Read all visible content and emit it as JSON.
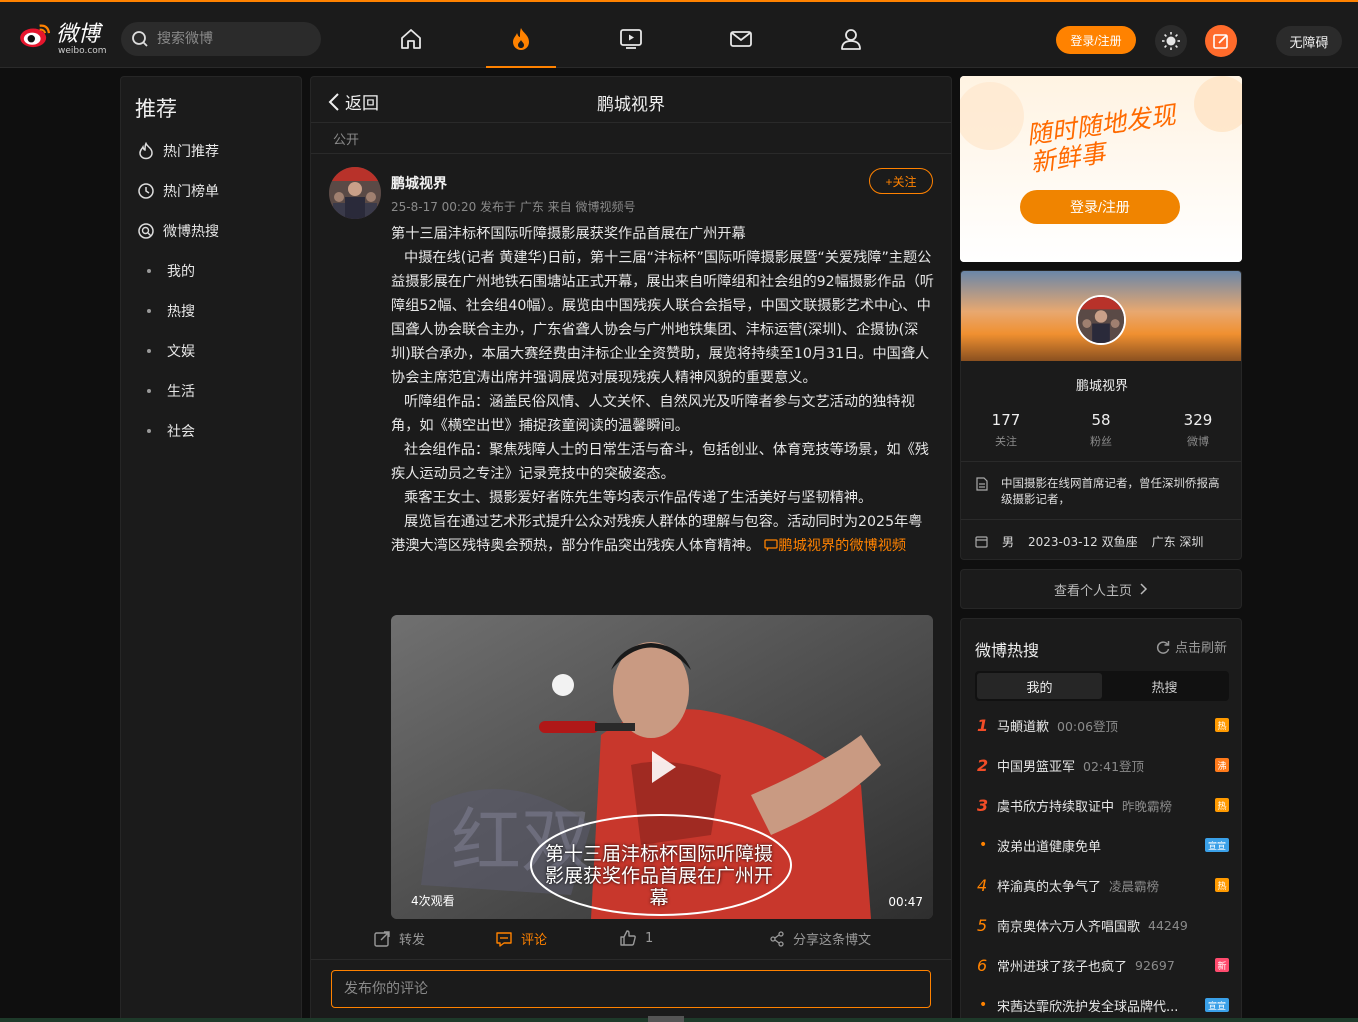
{
  "header": {
    "logo_text": "微博",
    "logo_sub": "weibo.com",
    "search_placeholder": "搜索微博",
    "login_label": "登录/注册",
    "accessibility_label": "无障碍"
  },
  "sidebar": {
    "title": "推荐",
    "items": [
      {
        "label": "热门推荐",
        "icon": "fire-icon"
      },
      {
        "label": "热门榜单",
        "icon": "clock-icon"
      },
      {
        "label": "微博热搜",
        "icon": "search-circle-icon"
      },
      {
        "label": "我的",
        "icon": "dot"
      },
      {
        "label": "热搜",
        "icon": "dot"
      },
      {
        "label": "文娱",
        "icon": "dot"
      },
      {
        "label": "生活",
        "icon": "dot"
      },
      {
        "label": "社会",
        "icon": "dot"
      }
    ]
  },
  "post": {
    "back_label": "返回",
    "page_title": "鹏城视界",
    "visibility": "公开",
    "author": "鹏城视界",
    "meta": "25-8-17 00:20 发布于 广东 来自 微博视频号",
    "follow_label": "+关注",
    "paragraphs": [
      "第十三届沣标杯国际听障摄影展获奖作品首展在广州开幕",
      "中摄在线(记者 黄建华)日前，第十三届“沣标杯”国际听障摄影展暨“关爱残障”主题公益摄影展在广州地铁石围塘站正式开幕，展出来自听障组和社会组的92幅摄影作品（听障组52幅、社会组40幅）。展览由中国残疾人联合会指导，中国文联摄影艺术中心、中国聋人协会联合主办，广东省聋人协会与广州地铁集团、沣标运营(深圳)、企摄协(深圳)联合承办，本届大赛经费由沣标企业全资赞助，展览将持续至10月31日。中国聋人协会主席范宜涛出席并强调展览对展现残疾人精神风貌的重要意义。",
      "听障组作品：涵盖民俗风情、人文关怀、自然风光及听障者参与文艺活动的独特视角，如《横空出世》捕捉孩童阅读的温馨瞬间。",
      "社会组作品：聚焦残障人士的日常生活与奋斗，包括创业、体育竞技等场景，如《残疾人运动员之专注》记录竞技中的突破姿态。",
      "乘客王女士、摄影爱好者陈先生等均表示作品传递了生活美好与坚韧精神。",
      "展览旨在通过艺术形式提升公众对残疾人群体的理解与包容。活动同时为2025年粤港澳大湾区残特奥会预热，部分作品突出残疾人体育精神。"
    ],
    "video_link": "鹏城视界的微博视频",
    "video": {
      "views": "4次观看",
      "duration": "00:47",
      "caption": "第十三届沣标杯国际听障摄影展获奖作品首展在广州开幕"
    },
    "actions": {
      "repost": "转发",
      "comment": "评论",
      "like_count": "1",
      "share": "分享这条博文"
    },
    "comment_placeholder": "发布你的评论"
  },
  "promo": {
    "slogan": "随时随地发现新鲜事",
    "button": "登录/注册"
  },
  "profile": {
    "name": "鹏城视界",
    "stats": [
      {
        "num": "177",
        "label": "关注"
      },
      {
        "num": "58",
        "label": "粉丝"
      },
      {
        "num": "329",
        "label": "微博"
      }
    ],
    "desc": "中国摄影在线网首席记者，曾任深圳侨报高级摄影记者，",
    "gender": "男",
    "birthday": "2023-03-12 双鱼座",
    "location": "广东 深圳",
    "home_link": "查看个人主页"
  },
  "hot_search": {
    "title": "微博热搜",
    "refresh": "点击刷新",
    "tabs": [
      "我的",
      "热搜"
    ],
    "items": [
      {
        "rank": "1",
        "text": "马頔道歉",
        "extra": "00:06登顶",
        "badge": "热",
        "badge_color": "#ff9a00"
      },
      {
        "rank": "2",
        "text": "中国男篮亚军",
        "extra": "02:41登顶",
        "badge": "沸",
        "badge_color": "#ff7a1a"
      },
      {
        "rank": "3",
        "text": "虞书欣方持续取证中",
        "extra": "昨晚霸榜",
        "badge": "热",
        "badge_color": "#ff9a00"
      },
      {
        "rank": "•",
        "text": "波弟出道健康免单",
        "extra": "",
        "badge": "宣宣",
        "badge_color": "#3aa0e8"
      },
      {
        "rank": "4",
        "text": "梓渝真的太争气了",
        "extra": "凌晨霸榜",
        "badge": "热",
        "badge_color": "#ff9a00"
      },
      {
        "rank": "5",
        "text": "南京奥体六万人齐唱国歌",
        "extra": "44249",
        "badge": "",
        "badge_color": ""
      },
      {
        "rank": "6",
        "text": "常州进球了孩子也疯了",
        "extra": "92697",
        "badge": "新",
        "badge_color": "#ff4b6e"
      },
      {
        "rank": "•",
        "text": "宋茜达霏欣洗护发全球品牌代...",
        "extra": "",
        "badge": "宣宣",
        "badge_color": "#3aa0e8"
      }
    ]
  }
}
